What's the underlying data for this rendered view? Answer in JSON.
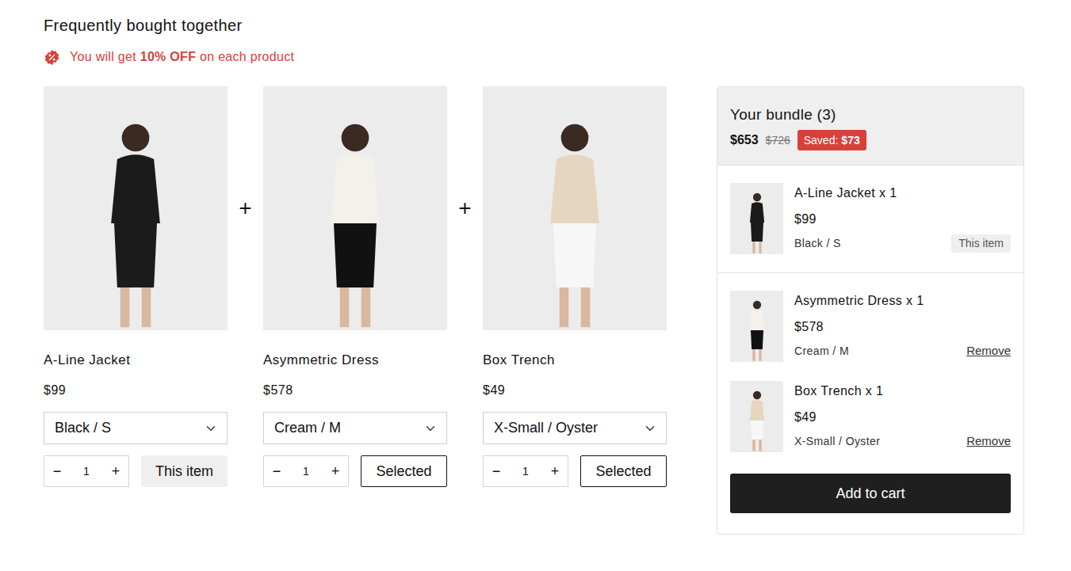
{
  "title": "Frequently bought together",
  "discount": {
    "prefix": "You will get ",
    "amount": "10% OFF",
    "suffix": " on each product"
  },
  "separator": "+",
  "quantity_controls": {
    "minus": "−",
    "plus": "+"
  },
  "products": [
    {
      "name": "A-Line Jacket",
      "price": "$99",
      "variant": "Black / S",
      "quantity": "1",
      "button": "This item",
      "kind": "current",
      "selected": true
    },
    {
      "name": "Asymmetric Dress",
      "price": "$578",
      "variant": "Cream / M",
      "quantity": "1",
      "button": "Selected",
      "kind": "option",
      "selected": true
    },
    {
      "name": "Box Trench",
      "price": "$49",
      "variant": "X-Small / Oyster",
      "quantity": "1",
      "button": "Selected",
      "kind": "option",
      "selected": true
    }
  ],
  "bundle": {
    "title": "Your bundle (3)",
    "price": "$653",
    "original_price": "$726",
    "saved_label": "Saved:",
    "saved_amount": "$73",
    "items": [
      {
        "name": "A-Line Jacket x 1",
        "price": "$99",
        "variant": "Black / S",
        "action": "This item",
        "kind": "current"
      },
      {
        "name": "Asymmetric Dress x 1",
        "price": "$578",
        "variant": "Cream / M",
        "action": "Remove",
        "kind": "option"
      },
      {
        "name": "Box Trench x 1",
        "price": "$49",
        "variant": "X-Small / Oyster",
        "action": "Remove",
        "kind": "option"
      }
    ],
    "button": "Add to cart"
  }
}
